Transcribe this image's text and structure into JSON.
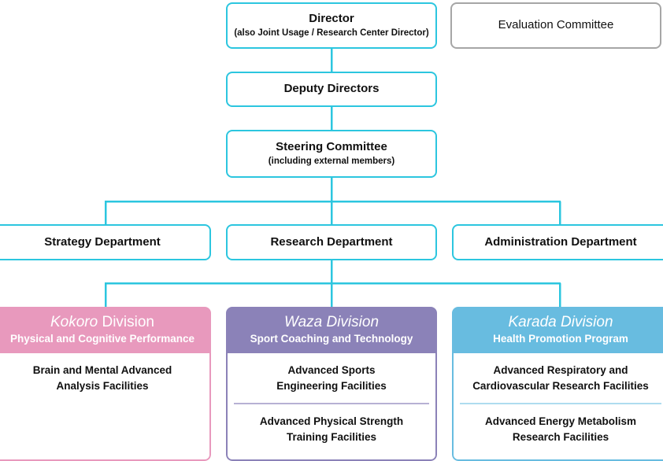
{
  "colors": {
    "connector": "#2cc6df",
    "node_border": "#2cc6df",
    "gray_border": "#a6a6a6",
    "kokoro": "#e899bd",
    "waza": "#8b82b8",
    "karada": "#68bce0",
    "text": "#101010",
    "background": "#ffffff"
  },
  "nodes": {
    "director": {
      "title": "Director",
      "subtitle": "(also Joint Usage / Research Center Director)"
    },
    "evaluation_committee": {
      "title": "Evaluation Committee"
    },
    "deputy_directors": {
      "title": "Deputy Directors"
    },
    "steering_committee": {
      "title": "Steering Committee",
      "subtitle": "(including external members)"
    }
  },
  "departments": [
    {
      "title": "Strategy Department"
    },
    {
      "title": "Research Department"
    },
    {
      "title": "Administration Department"
    }
  ],
  "divisions": [
    {
      "key": "kokoro",
      "name_italic": "Kokoro",
      "name_rest": " Division",
      "subtitle": "Physical and Cognitive Performance",
      "color": "#e899bd",
      "facilities": [
        "Brain and Mental Advanced\nAnalysis Facilities"
      ]
    },
    {
      "key": "waza",
      "name_italic": "Waza Division",
      "name_rest": "",
      "subtitle": "Sport Coaching and Technology",
      "color": "#8b82b8",
      "facilities": [
        "Advanced Sports\nEngineering Facilities",
        "Advanced Physical Strength\nTraining Facilities"
      ]
    },
    {
      "key": "karada",
      "name_italic": "Karada Division",
      "name_rest": "",
      "subtitle": "Health Promotion Program",
      "color": "#68bce0",
      "facilities": [
        "Advanced Respiratory and\nCardiovascular Research Facilities",
        "Advanced Energy Metabolism\nResearch Facilities"
      ]
    }
  ]
}
